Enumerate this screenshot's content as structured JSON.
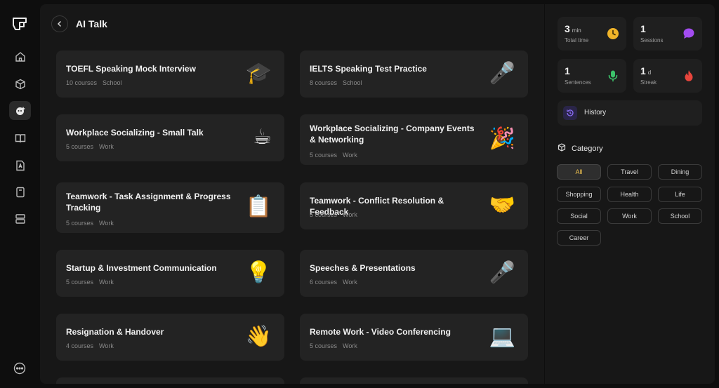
{
  "page": {
    "title": "AI Talk"
  },
  "cards": [
    {
      "title": "TOEFL Speaking Mock Interview",
      "count": "10 courses",
      "tag": "School",
      "emoji": "🎓"
    },
    {
      "title": "IELTS Speaking Test Practice",
      "count": "8 courses",
      "tag": "School",
      "emoji": "🎤"
    },
    {
      "title": "Workplace Socializing - Small Talk",
      "count": "5 courses",
      "tag": "Work",
      "emoji": "☕"
    },
    {
      "title": "Workplace Socializing - Company Events & Networking",
      "count": "5 courses",
      "tag": "Work",
      "emoji": "🎉"
    },
    {
      "title": "Teamwork - Task Assignment & Progress Tracking",
      "count": "5 courses",
      "tag": "Work",
      "emoji": "📋"
    },
    {
      "title": "Teamwork - Conflict Resolution & Feedback",
      "count": "5 courses",
      "tag": "Work",
      "emoji": "🤝"
    },
    {
      "title": "Startup & Investment Communication",
      "count": "5 courses",
      "tag": "Work",
      "emoji": "💡"
    },
    {
      "title": "Speeches & Presentations",
      "count": "6 courses",
      "tag": "Work",
      "emoji": "🎤"
    },
    {
      "title": "Resignation & Handover",
      "count": "4 courses",
      "tag": "Work",
      "emoji": "👋"
    },
    {
      "title": "Remote Work - Video Conferencing",
      "count": "5 courses",
      "tag": "Work",
      "emoji": "💻"
    }
  ],
  "stats": {
    "time": {
      "value": "3",
      "unit": "min",
      "label": "Total time",
      "icon": "clock-icon",
      "color": "#f0b429"
    },
    "sessions": {
      "value": "1",
      "unit": "",
      "label": "Sessions",
      "icon": "chat-bubble-icon",
      "color": "#a34cf0"
    },
    "sentences": {
      "value": "1",
      "unit": "",
      "label": "Sentences",
      "icon": "microphone-icon",
      "color": "#3cc26a"
    },
    "streak": {
      "value": "1",
      "unit": "d",
      "label": "Streak",
      "icon": "flame-icon",
      "color": "#e8453c"
    }
  },
  "history": {
    "label": "History",
    "icon": "history-icon"
  },
  "category": {
    "heading": "Category",
    "items": [
      "All",
      "Travel",
      "Dining",
      "Shopping",
      "Health",
      "Life",
      "Social",
      "Work",
      "School",
      "Career"
    ],
    "selected": "All"
  },
  "colors": {
    "accent": "#f0c34f",
    "card": "#232323",
    "panel": "#171717"
  }
}
